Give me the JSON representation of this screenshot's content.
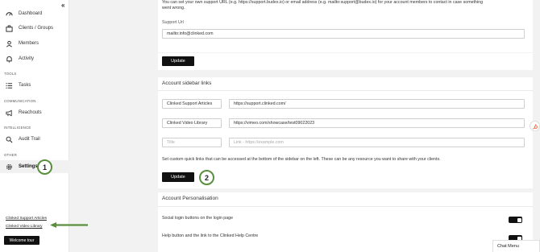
{
  "sidebar": {
    "items": [
      {
        "label": "Dashboard",
        "icon": "dashboard-icon"
      },
      {
        "label": "Clients / Groups",
        "icon": "briefcase-icon"
      },
      {
        "label": "Members",
        "icon": "members-icon"
      },
      {
        "label": "Activity",
        "icon": "bell-icon"
      },
      {
        "label": "Tasks",
        "icon": "list-icon"
      },
      {
        "label": "Reachouts",
        "icon": "megaphone-icon"
      },
      {
        "label": "Audit Trail",
        "icon": "search-icon"
      },
      {
        "label": "Settings",
        "icon": "gear-icon"
      }
    ],
    "sections": {
      "tools": "TOOLS",
      "communication": "COMMUNICATION",
      "intelligence": "INTELLIGENCE",
      "other": "OTHER"
    },
    "footer_links": [
      "Clinked Support Articles",
      "Clinked Video Library"
    ],
    "welcome_tour": "Welcome tour"
  },
  "callouts": [
    "1",
    "2"
  ],
  "support": {
    "desc_line1": "You can set your own support URL (e.g. https://support.budex.io) or email address (e.g. mailto:support@budex.io) for your account members to contact in case something",
    "desc_line2": "went wrong.",
    "url_label": "Support Url",
    "url_value": "mailto:info@clinked.com",
    "update": "Update"
  },
  "sidebar_links": {
    "title": "Account sidebar links",
    "rows": [
      {
        "title": "Clinked Support Articles",
        "link": "https://support.clinked.com/"
      },
      {
        "title": "Clinked Video Library",
        "link": "https://vimeo.com/showcase/test09022023"
      }
    ],
    "title_placeholder": "Title",
    "link_placeholder": "Link - https://example.com",
    "help": "Set custom quick links that can be accessed at the bottom of the sidebar on the left. These can be any resource you want to share with your clients.",
    "update": "Update"
  },
  "personalisation": {
    "title": "Account Personalisation",
    "social_login": "Social login buttons on the login page",
    "help_button": "Help button and the link to the Clinked Help Centre",
    "social_login_on": true,
    "help_button_on": true
  },
  "chat": "Chat Menu",
  "colors": {
    "accent_green": "#5a8f3e",
    "button_black": "#111111"
  }
}
